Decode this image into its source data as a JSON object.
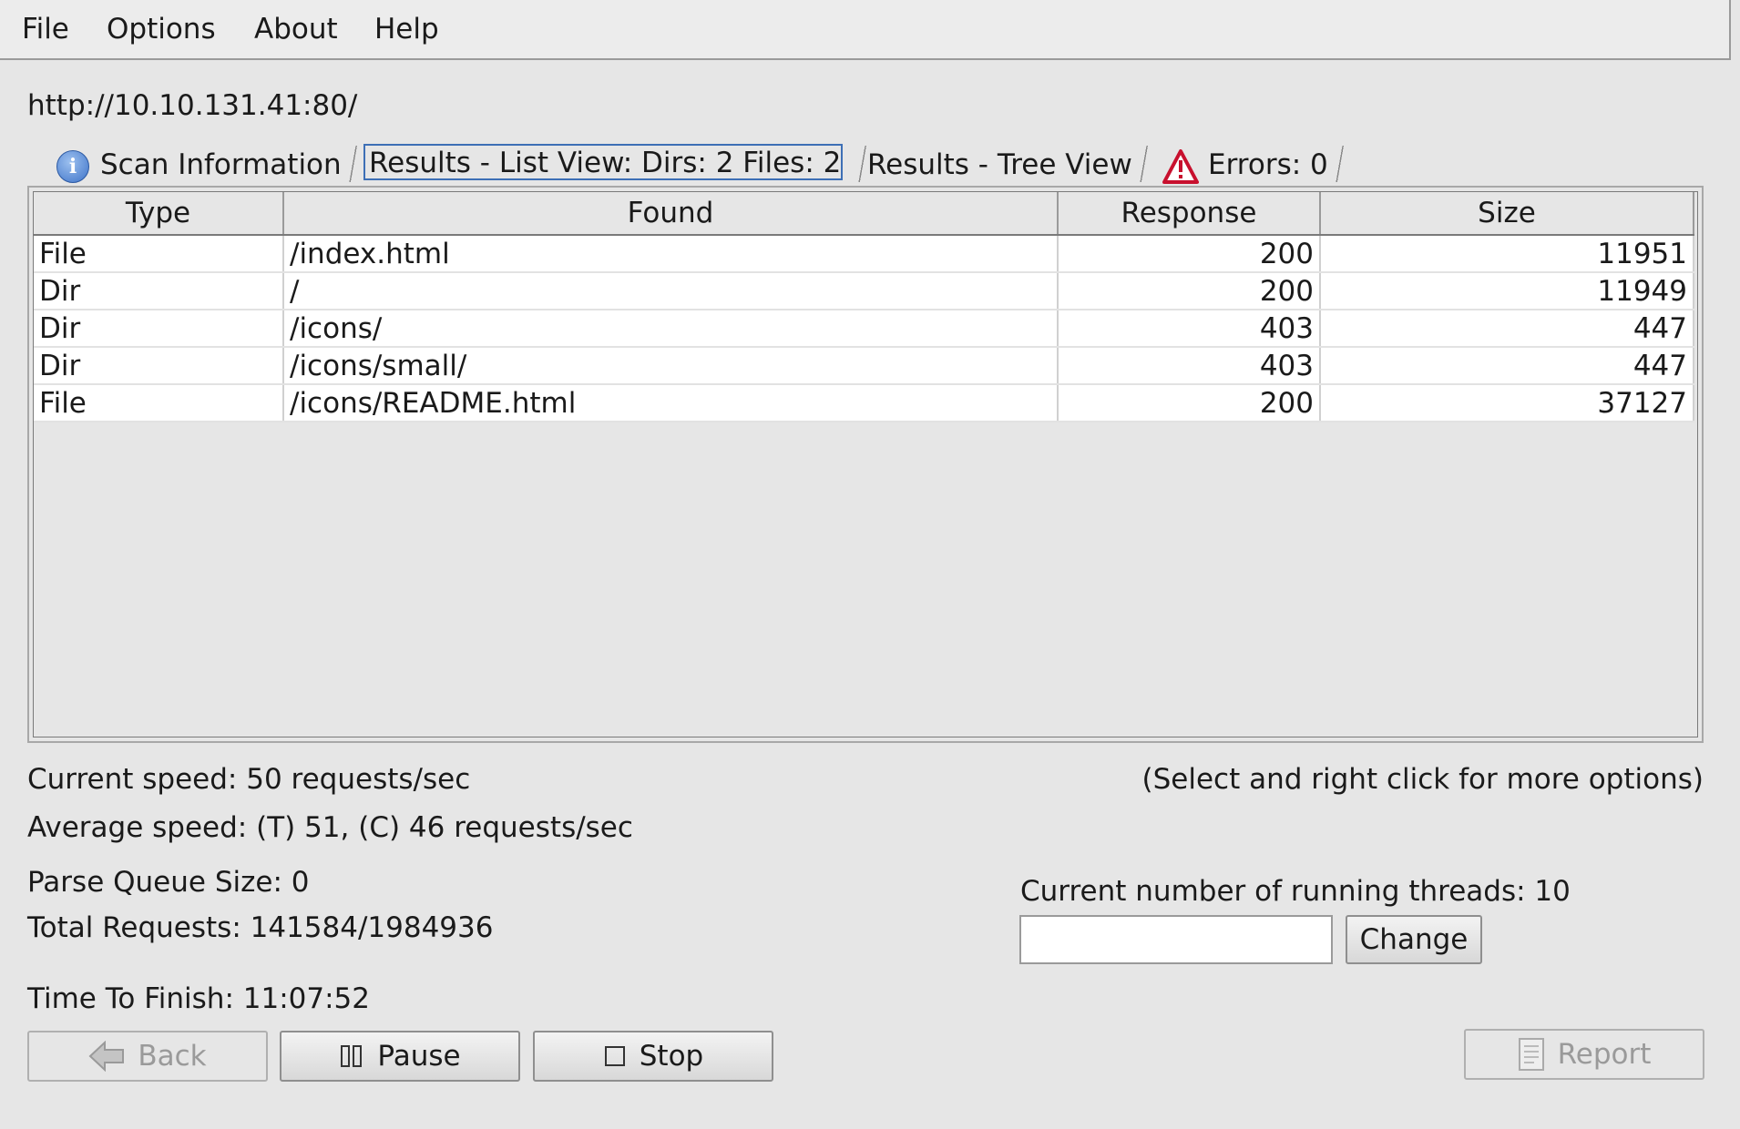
{
  "menu": [
    "File",
    "Options",
    "About",
    "Help"
  ],
  "target_url": "http://10.10.131.41:80/",
  "tabs": {
    "scan_info": "Scan Information",
    "list_view": "Results - List View: Dirs: 2 Files: 2",
    "tree_view": "Results - Tree View",
    "errors": "Errors: 0"
  },
  "table": {
    "headers": [
      "Type",
      "Found",
      "Response",
      "Size"
    ],
    "rows": [
      [
        "File",
        "/index.html",
        "200",
        "11951"
      ],
      [
        "Dir",
        "/",
        "200",
        "11949"
      ],
      [
        "Dir",
        "/icons/",
        "403",
        "447"
      ],
      [
        "Dir",
        "/icons/small/",
        "403",
        "447"
      ],
      [
        "File",
        "/icons/README.html",
        "200",
        "37127"
      ]
    ]
  },
  "status": {
    "current_speed": "Current speed: 50 requests/sec",
    "hint": "(Select and right click for more options)",
    "average_speed": "Average speed: (T) 51, (C) 46 requests/sec",
    "parse_queue": "Parse Queue Size: 0",
    "total_requests": "Total Requests: 141584/1984936",
    "time_to_finish": "Time To Finish: 11:07:52",
    "threads": "Current number of running threads: 10"
  },
  "threads_input_value": "",
  "buttons": {
    "change": "Change",
    "back": "Back",
    "pause": "Pause",
    "stop": "Stop",
    "report": "Report"
  },
  "icons": {
    "info": "info-icon",
    "warning": "warning-icon",
    "back": "back-arrow-icon",
    "pause": "pause-icon",
    "stop": "stop-icon",
    "report": "report-icon"
  }
}
